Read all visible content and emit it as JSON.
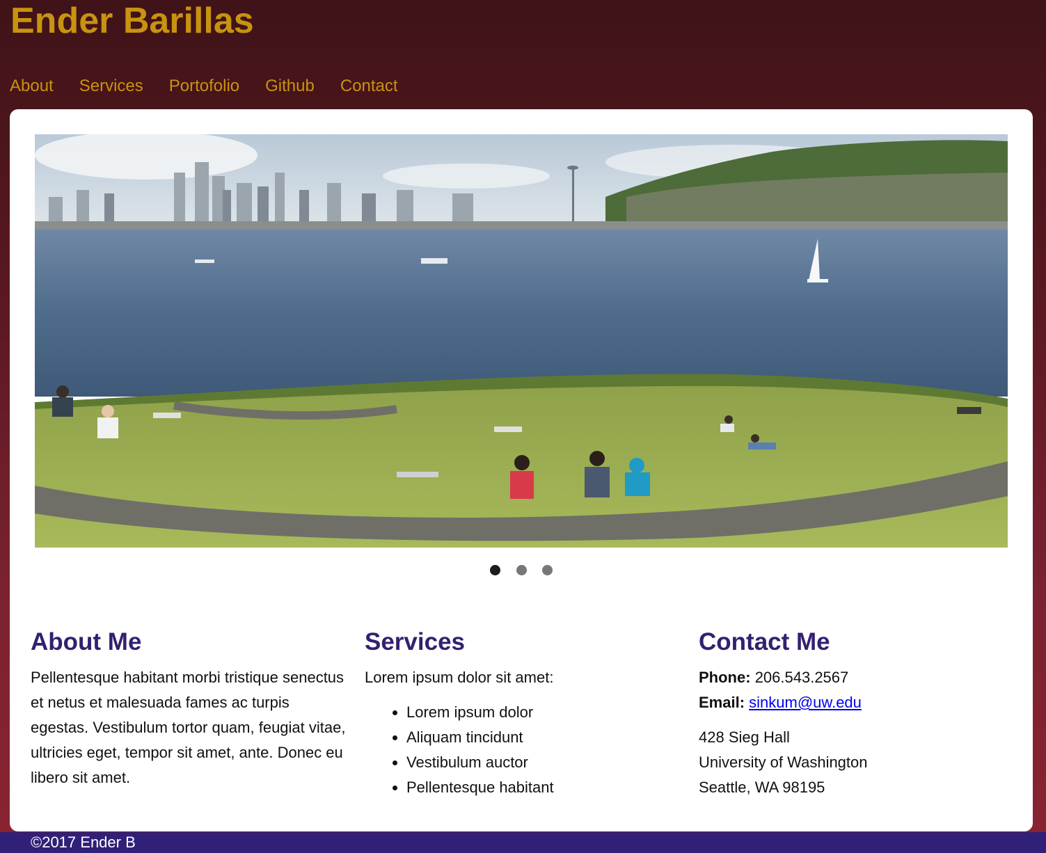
{
  "header": {
    "title": "Ender Barillas"
  },
  "nav": [
    {
      "label": "About"
    },
    {
      "label": "Services"
    },
    {
      "label": "Portofolio"
    },
    {
      "label": "Github"
    },
    {
      "label": "Contact"
    }
  ],
  "carousel": {
    "slide_count": 3,
    "active_index": 0
  },
  "about": {
    "heading": "About Me",
    "text": "Pellentesque habitant morbi tristique senectus et netus et malesuada fames ac turpis egestas. Vestibulum tortor quam, feugiat vitae, ultricies eget, tempor sit amet, ante. Donec eu libero sit amet."
  },
  "services": {
    "heading": "Services",
    "intro": "Lorem ipsum dolor sit amet:",
    "items": [
      "Lorem ipsum dolor",
      "Aliquam tincidunt",
      "Vestibulum auctor",
      "Pellentesque habitant"
    ]
  },
  "contact": {
    "heading": "Contact Me",
    "phone_label": "Phone:",
    "phone": "206.543.2567",
    "email_label": "Email:",
    "email": "sinkum@uw.edu",
    "address": [
      "428 Sieg Hall",
      "University of Washington",
      "Seattle, WA 98195"
    ]
  },
  "footer": {
    "text": "©2017 Ender B"
  },
  "colors": {
    "header_bg": "#3f1318",
    "accent_gold": "#c8930f",
    "heading_purple": "#33206f",
    "footer_bg": "#312078"
  }
}
